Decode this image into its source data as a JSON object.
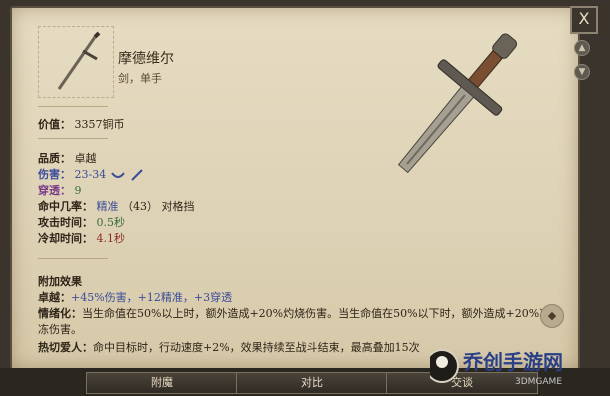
{
  "window": {
    "close_label": "X"
  },
  "item": {
    "name": "摩德维尔",
    "type": "剑，单手",
    "value_label": "价值：",
    "value": "3357铜币"
  },
  "stats": {
    "quality_label": "品质：",
    "quality": "卓越",
    "damage_label": "伤害：",
    "damage": "23-34",
    "pierce_label": "穿透：",
    "pierce": "9",
    "accuracy_label": "命中几率：",
    "accuracy_name": "精准",
    "accuracy_value": "（43）",
    "accuracy_suffix": "对格挡",
    "attack_time_label": "攻击时间：",
    "attack_time": "0.5秒",
    "recovery_label": "冷却时间：",
    "recovery": "4.1秒"
  },
  "effects": {
    "header": "附加效果",
    "lines": [
      {
        "label": "卓越：",
        "text": "+45%伤害，+12精准，+3穿透"
      },
      {
        "label": "情绪化：",
        "text": "当生命值在50%以上时，额外造成+20%灼烧伤害。当生命值在50%以下时，额外造成+20%冰冻伤害。"
      },
      {
        "label": "热切爱人：",
        "text": "命中目标时，行动速度+2%，效果持续至战斗结束，最高叠加15次"
      }
    ]
  },
  "buttons": {
    "enchant": "附魔",
    "compare": "对比",
    "talk": "交谈"
  },
  "watermark": {
    "main": "乔创手游网",
    "sub": "3DMGAME"
  },
  "colors": {
    "accent_blue": "#3c4c9a",
    "accent_purple": "#7a3a8a",
    "good_green": "#3d6b3a",
    "bad_red": "#8a2e22"
  }
}
